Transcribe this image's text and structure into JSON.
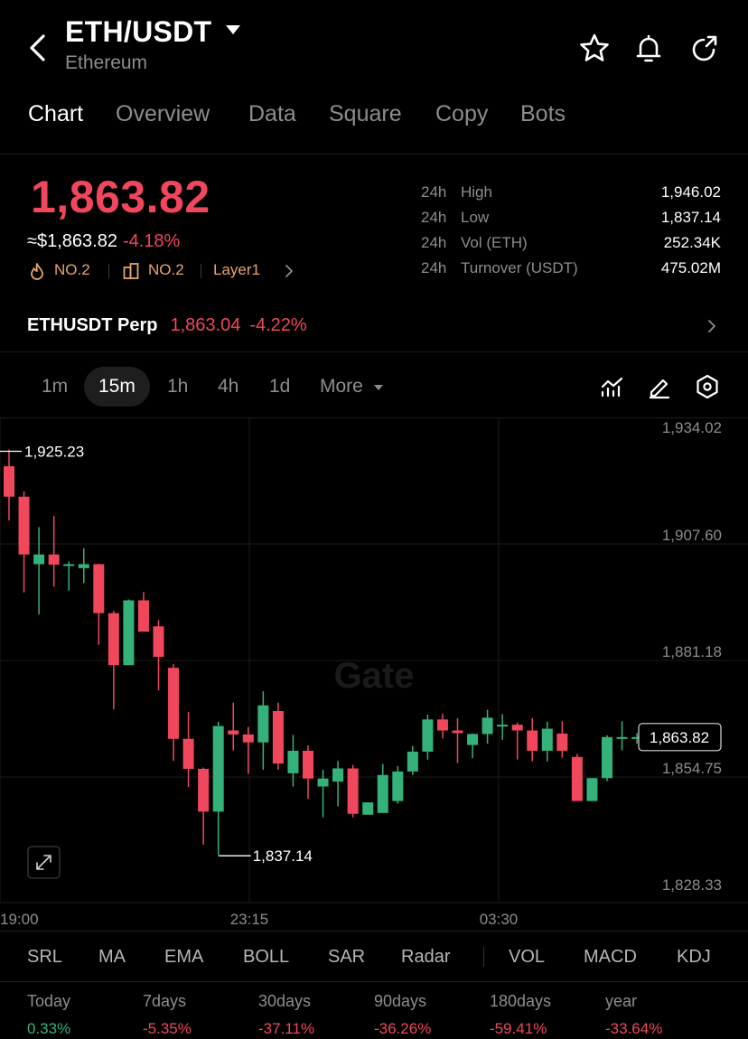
{
  "header": {
    "pair": "ETH/USDT",
    "name": "Ethereum",
    "icons": [
      "back-arrow-icon",
      "dropdown-caret-icon",
      "star-icon",
      "bell-icon",
      "share-icon"
    ]
  },
  "tabs": [
    "Chart",
    "Overview",
    "Data",
    "Square",
    "Copy",
    "Bots"
  ],
  "active_tab": "Chart",
  "quote": {
    "price": "1,863.82",
    "approx": "≈$1,863.82",
    "change": "-4.18%",
    "tags": [
      "NO.2",
      "NO.2",
      "Layer1"
    ]
  },
  "stats": [
    {
      "k1": "24h",
      "k2": "High",
      "v": "1,946.02"
    },
    {
      "k1": "24h",
      "k2": "Low",
      "v": "1,837.14"
    },
    {
      "k1": "24h",
      "k2": "Vol (ETH)",
      "v": "252.34K"
    },
    {
      "k1": "24h",
      "k2": "Turnover (USDT)",
      "v": "475.02M"
    }
  ],
  "perp": {
    "name": "ETHUSDT Perp",
    "price": "1,863.04",
    "change": "-4.22%"
  },
  "intervals": [
    "1m",
    "15m",
    "1h",
    "4h",
    "1d",
    "More"
  ],
  "active_interval": "15m",
  "chart_data": {
    "type": "candlestick",
    "ticks_y": [
      "1,934.02",
      "1,907.60",
      "1,881.18",
      "1,854.75",
      "1,828.33"
    ],
    "ylim": [
      1828.33,
      1934.02
    ],
    "ticks_x": [
      "19:00",
      "23:15",
      "03:30"
    ],
    "watermark": "Gate",
    "high_label": "1,925.23",
    "low_label": "1,837.14",
    "current_label": "1,863.82",
    "candles": [
      [
        1925.2,
        1929.0,
        1912.9,
        1918.3
      ],
      [
        1918.3,
        1919.5,
        1896.6,
        1905.2
      ],
      [
        1903.0,
        1911.4,
        1891.6,
        1905.2
      ],
      [
        1905.2,
        1913.9,
        1897.9,
        1902.9
      ],
      [
        1902.9,
        1903.6,
        1897.0,
        1903.0
      ],
      [
        1902.1,
        1906.6,
        1898.7,
        1903.0
      ],
      [
        1903.0,
        1903.1,
        1884.7,
        1891.9
      ],
      [
        1891.9,
        1892.4,
        1870.1,
        1880.1
      ],
      [
        1880.1,
        1895.0,
        1880.1,
        1894.8
      ],
      [
        1894.8,
        1896.7,
        1887.7,
        1887.7
      ],
      [
        1888.9,
        1890.3,
        1874.4,
        1882.0
      ],
      [
        1879.5,
        1880.3,
        1858.4,
        1863.4
      ],
      [
        1863.4,
        1869.5,
        1852.5,
        1856.6
      ],
      [
        1856.6,
        1856.9,
        1839.4,
        1846.9
      ],
      [
        1846.9,
        1867.3,
        1837.1,
        1866.3
      ],
      [
        1865.3,
        1871.6,
        1860.8,
        1864.4
      ],
      [
        1864.4,
        1866.1,
        1855.5,
        1862.6
      ],
      [
        1862.6,
        1874.2,
        1856.4,
        1871.0
      ],
      [
        1869.7,
        1871.6,
        1856.4,
        1857.8
      ],
      [
        1855.6,
        1864.3,
        1852.6,
        1860.7
      ],
      [
        1860.7,
        1861.9,
        1849.8,
        1854.4
      ],
      [
        1852.6,
        1856.4,
        1845.6,
        1854.4
      ],
      [
        1853.7,
        1858.4,
        1848.1,
        1856.7
      ],
      [
        1856.7,
        1857.5,
        1845.6,
        1846.4
      ],
      [
        1846.2,
        1846.7,
        1847.0,
        1849.0
      ],
      [
        1846.6,
        1857.7,
        1846.6,
        1855.2
      ],
      [
        1849.3,
        1857.2,
        1848.7,
        1856.0
      ],
      [
        1856.0,
        1861.8,
        1855.2,
        1860.5
      ],
      [
        1860.5,
        1868.9,
        1858.7,
        1867.8
      ],
      [
        1867.8,
        1869.1,
        1863.5,
        1865.3
      ],
      [
        1865.3,
        1868.1,
        1857.9,
        1864.7
      ],
      [
        1862.0,
        1864.6,
        1859.0,
        1864.5
      ],
      [
        1864.5,
        1870.0,
        1862.3,
        1868.2
      ],
      [
        1866.6,
        1869.0,
        1863.2,
        1866.6
      ],
      [
        1866.6,
        1867.1,
        1858.7,
        1865.3
      ],
      [
        1865.3,
        1868.1,
        1858.3,
        1860.7
      ],
      [
        1860.7,
        1867.3,
        1858.3,
        1865.7
      ],
      [
        1864.6,
        1867.4,
        1859.1,
        1860.7
      ],
      [
        1859.3,
        1860.0,
        1849.3,
        1849.3
      ],
      [
        1849.3,
        1854.5,
        1850.9,
        1854.5
      ],
      [
        1854.5,
        1864.2,
        1853.8,
        1863.8
      ],
      [
        1863.4,
        1867.4,
        1860.8,
        1863.8
      ],
      [
        1863.8,
        1864.7,
        1862.3,
        1863.8
      ]
    ]
  },
  "indicators": [
    "SRL",
    "MA",
    "EMA",
    "BOLL",
    "SAR",
    "Radar",
    "VOL",
    "MACD",
    "KDJ"
  ],
  "performance": [
    {
      "label": "Today",
      "value": "0.33%",
      "dir": "pos"
    },
    {
      "label": "7days",
      "value": "-5.35%",
      "dir": "neg"
    },
    {
      "label": "30days",
      "value": "-37.11%",
      "dir": "neg"
    },
    {
      "label": "90days",
      "value": "-36.26%",
      "dir": "neg"
    },
    {
      "label": "180days",
      "value": "-59.41%",
      "dir": "neg"
    },
    {
      "label": "year",
      "value": "-33.64%",
      "dir": "neg"
    }
  ],
  "colors": {
    "up": "#35b27a",
    "down": "#f0475c",
    "accent": "#e7a56b"
  }
}
